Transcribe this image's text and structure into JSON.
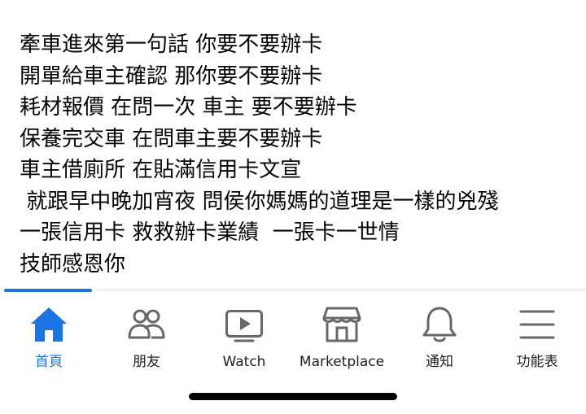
{
  "post": {
    "lines": [
      "牽車進來第一句話 你要不要辦卡",
      "開單給車主確認 那你要不要辦卡",
      "耗材報價 在問一次 車主 要不要辦卡",
      "保養完交車 在問車主要不要辦卡",
      "車主借廁所 在貼滿信用卡文宣",
      " 就跟早中晚加宵夜 問侯你媽媽的道理是一樣的兇殘",
      "一張信用卡 救救辦卡業績  一張卡一世情",
      "技師感恩你"
    ]
  },
  "tabbar": {
    "active_color": "#1b74e4",
    "inactive_color": "#1c1e21",
    "tabs": [
      {
        "label": "首頁",
        "icon": "home-icon",
        "active": true
      },
      {
        "label": "朋友",
        "icon": "friends-icon",
        "active": false
      },
      {
        "label": "Watch",
        "icon": "watch-icon",
        "active": false
      },
      {
        "label": "Marketplace",
        "icon": "marketplace-icon",
        "active": false
      },
      {
        "label": "通知",
        "icon": "bell-icon",
        "active": false
      },
      {
        "label": "功能表",
        "icon": "menu-icon",
        "active": false
      }
    ]
  }
}
